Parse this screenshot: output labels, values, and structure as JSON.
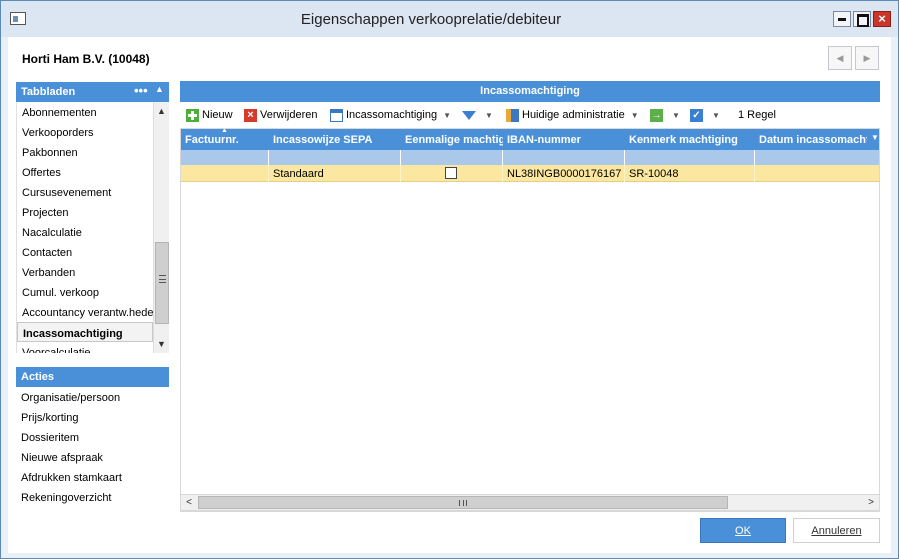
{
  "window": {
    "title": "Eigenschappen verkooprelatie/debiteur",
    "close_label": "×"
  },
  "customer": {
    "name": "Horti Ham B.V. (10048)"
  },
  "nav": {
    "prev": "◀",
    "next": "▶"
  },
  "tabbladen": {
    "heading": "Tabbladen",
    "dots": "•••",
    "collapse": "▲",
    "items": [
      "Abonnementen",
      "Verkooporders",
      "Pakbonnen",
      "Offertes",
      "Cursusevenement",
      "Projecten",
      "Nacalculatie",
      "Contacten",
      "Verbanden",
      "Cumul. verkoop",
      "Accountancy verantw.hedenn",
      "Incassomachtiging",
      "Voorcalculatie"
    ],
    "active_index": 11,
    "scroll_up": "▲",
    "scroll_down": "▼"
  },
  "acties": {
    "heading": "Acties",
    "items": [
      "Organisatie/persoon",
      "Prijs/korting",
      "Dossieritem",
      "Nieuwe afspraak",
      "Afdrukken stamkaart",
      "Rekeningoverzicht"
    ]
  },
  "panel": {
    "title": "Incassomachtiging"
  },
  "toolbar": {
    "new": "Nieuw",
    "delete": "Verwijderen",
    "incasso": "Incassomachtiging",
    "admin": "Huidige administratie",
    "dropdown": "▼",
    "arrow_icon": "→",
    "check_icon": "✓",
    "count": "1 Regel"
  },
  "grid": {
    "columns": [
      "Factuurnr.",
      "Incassowijze SEPA",
      "Eenmalige machtiging",
      "IBAN-nummer",
      "Kenmerk machtiging",
      "Datum incassomachtiging"
    ],
    "sort_mark": "▲",
    "header_dropdown": "▼",
    "rows": [
      {
        "factuurnr": "",
        "incassowijze": "Standaard",
        "eenmalig": false,
        "iban": "NL38INGB0000176167",
        "kenmerk": "SR-10048",
        "datum": ""
      }
    ]
  },
  "hscroll": {
    "left": "<",
    "right": ">"
  },
  "buttons": {
    "ok": "OK",
    "cancel": "Annuleren"
  }
}
